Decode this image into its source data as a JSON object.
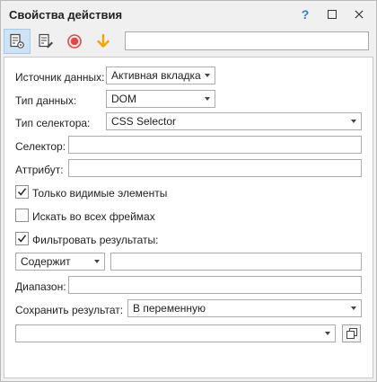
{
  "window": {
    "title": "Свойства действия"
  },
  "titlebar": {
    "help_icon": "?",
    "maximize_icon": "maximize-icon",
    "close_icon": "close-icon"
  },
  "toolbar": {
    "tools": [
      "settings-doc-icon",
      "edit-doc-icon",
      "record-icon",
      "arrow-down-icon"
    ],
    "search_value": "",
    "accent_record": "#e84545",
    "accent_arrow": "#f0a500"
  },
  "form": {
    "data_source": {
      "label": "Источник данных:",
      "value": "Активная вкладка"
    },
    "data_type": {
      "label": "Тип данных:",
      "value": "DOM"
    },
    "selector_type": {
      "label": "Тип селектора:",
      "value": "CSS Selector"
    },
    "selector": {
      "label": "Селектор:",
      "value": ""
    },
    "attribute": {
      "label": "Аттрибут:",
      "value": ""
    },
    "only_visible": {
      "label": "Только видимые элементы",
      "checked": true
    },
    "all_frames": {
      "label": "Искать во всех фреймах",
      "checked": false
    },
    "filter_results": {
      "label": "Фильтровать результаты:",
      "checked": true
    },
    "filter_mode": {
      "value": "Содержит"
    },
    "filter_value": {
      "value": ""
    },
    "range": {
      "label": "Диапазон:",
      "value": ""
    },
    "save_result": {
      "label": "Сохранить результат:",
      "value": "В переменную"
    },
    "variable": {
      "value": ""
    }
  }
}
